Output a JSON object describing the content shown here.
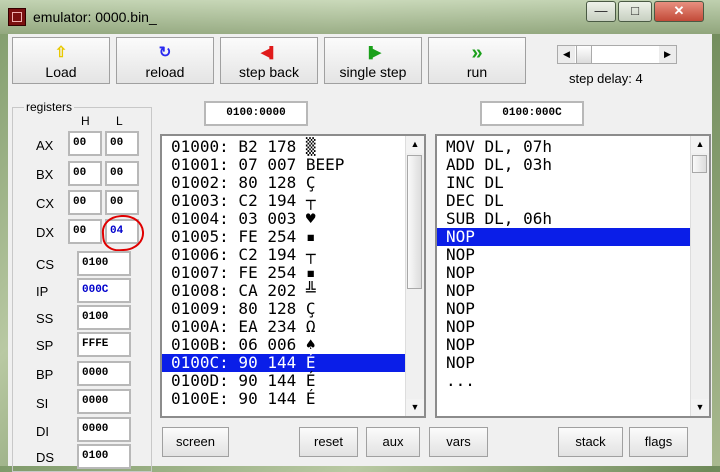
{
  "window": {
    "title": "emulator: 0000.bin_",
    "minimize": "—",
    "maximize": "□",
    "close": "✕"
  },
  "toolbar": {
    "buttons": [
      {
        "name": "load-button",
        "label": "Load",
        "icon": "arrow-up-icon",
        "glyph": "⇧",
        "color": "#e8c800"
      },
      {
        "name": "reload-button",
        "label": "reload",
        "icon": "reload-icon",
        "glyph": "↻",
        "color": "#2a2af0"
      },
      {
        "name": "step-back-button",
        "label": "step back",
        "icon": "step-back-icon",
        "glyph": "◀▌",
        "color": "#e01a1a"
      },
      {
        "name": "single-step-button",
        "label": "single step",
        "icon": "single-step-icon",
        "glyph": "▐▶",
        "color": "#1aa01a"
      },
      {
        "name": "run-button",
        "label": "run",
        "icon": "run-icon",
        "glyph": "»",
        "color": "#1aa01a"
      }
    ],
    "step_delay_label": "step delay: 4",
    "slider_left": "◀",
    "slider_right": "▶"
  },
  "registers": {
    "group_label": "registers",
    "h_header": "H",
    "l_header": "L",
    "general": [
      {
        "name": "AX",
        "h": "00",
        "l": "00"
      },
      {
        "name": "BX",
        "h": "00",
        "l": "00"
      },
      {
        "name": "CX",
        "h": "00",
        "l": "00"
      },
      {
        "name": "DX",
        "h": "00",
        "l": "04"
      }
    ],
    "segment": [
      {
        "name": "CS",
        "value": "0100"
      },
      {
        "name": "IP",
        "value": "000C"
      },
      {
        "name": "SS",
        "value": "0100"
      },
      {
        "name": "SP",
        "value": "FFFE"
      },
      {
        "name": "BP",
        "value": "0000"
      },
      {
        "name": "SI",
        "value": "0000"
      },
      {
        "name": "DI",
        "value": "0000"
      },
      {
        "name": "DS",
        "value": "0100"
      }
    ]
  },
  "memory": {
    "address": "0100:0000",
    "rows": [
      "01000: B2 178 ▒",
      "01001: 07 007 BEEP",
      "01002: 80 128 Ç",
      "01003: C2 194 ┬",
      "01004: 03 003 ♥",
      "01005: FE 254 ▪",
      "01006: C2 194 ┬",
      "01007: FE 254 ▪",
      "01008: CA 202 ╩",
      "01009: 80 128 Ç",
      "0100A: EA 234 Ω",
      "0100B: 06 006 ♠",
      "0100C: 90 144 É",
      "0100D: 90 144 É",
      "0100E: 90 144 É"
    ],
    "selected_index": 12
  },
  "disassembly": {
    "address": "0100:000C",
    "rows": [
      "MOV DL, 07h",
      "ADD DL, 03h",
      "INC DL",
      "DEC DL",
      "SUB DL, 06h",
      "NOP",
      "NOP",
      "NOP",
      "NOP",
      "NOP",
      "NOP",
      "NOP",
      "NOP",
      "..."
    ],
    "selected_index": 5
  },
  "bottom_buttons": [
    {
      "name": "screen-button",
      "label": "screen"
    },
    {
      "name": "reset-button",
      "label": "reset"
    },
    {
      "name": "aux-button",
      "label": "aux"
    },
    {
      "name": "vars-button",
      "label": "vars"
    },
    {
      "name": "stack-button",
      "label": "stack"
    },
    {
      "name": "flags-button",
      "label": "flags"
    }
  ],
  "highlight_color": "#0a1ee8",
  "annotation_color": "#e00000"
}
